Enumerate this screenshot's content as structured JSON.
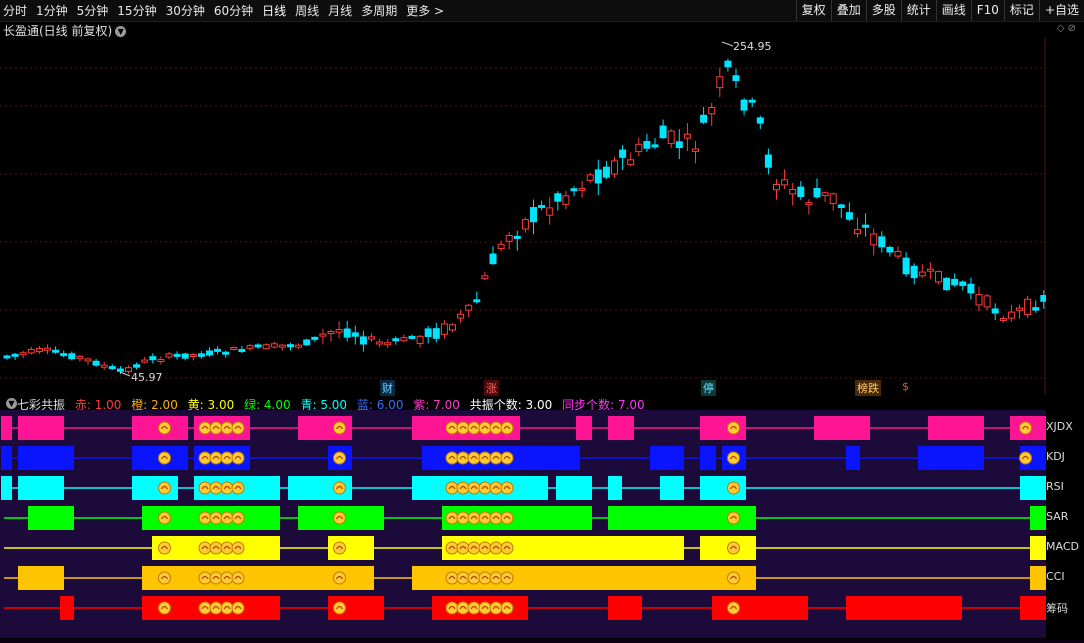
{
  "toolbar": {
    "periods": [
      "分时",
      "1分钟",
      "5分钟",
      "15分钟",
      "30分钟",
      "60分钟",
      "日线",
      "周线",
      "月线",
      "多周期",
      "更多 >"
    ],
    "tools": [
      "复权",
      "叠加",
      "多股",
      "统计",
      "画线",
      "F10",
      "标记",
      "+自选"
    ]
  },
  "chart": {
    "title": "长盈通(日线 前复权)",
    "high_label": "254.95",
    "low_label": "45.97",
    "icons": "◇ ⊘"
  },
  "events": [
    {
      "label": "财",
      "color": "#6fd0ff",
      "bg": "#0a2a44"
    },
    {
      "label": "涨",
      "color": "#ff6060",
      "bg": "#4a0a0a"
    },
    {
      "label": "停",
      "color": "#70e0ff",
      "bg": "#0a3a3a"
    },
    {
      "label": "榜跌",
      "color": "#ffcc66",
      "bg": "#4a2a0a"
    },
    {
      "label": "$",
      "color": "#ff4040",
      "bg": ""
    }
  ],
  "indicator": {
    "name": "七彩共振",
    "items": [
      {
        "text": "赤: 1.00",
        "color": "#ff3b3b"
      },
      {
        "text": "橙: 2.00",
        "color": "#ffb000"
      },
      {
        "text": "黄: 3.00",
        "color": "#ffff00"
      },
      {
        "text": "绿: 4.00",
        "color": "#00ff00"
      },
      {
        "text": "青: 5.00",
        "color": "#00ffff"
      },
      {
        "text": "蓝: 6.00",
        "color": "#3a6bff"
      },
      {
        "text": "紫: 7.00",
        "color": "#ff3bd0"
      },
      {
        "text": "共振个数: 3.00",
        "color": "#ffffff"
      },
      {
        "text": "同步个数: 7.00",
        "color": "#ff33ff"
      }
    ],
    "row_labels": [
      "XJDX",
      "KDJ",
      "RSI",
      "SAR",
      "MACD",
      "CCI",
      "筹码"
    ],
    "row_colors": [
      "#ff1493",
      "#0a14ff",
      "#00ffff",
      "#00ff00",
      "#ffff00",
      "#ffc400",
      "#ff0000"
    ]
  },
  "colors": {
    "up": "#ff3b3b",
    "down": "#00e5ff",
    "grid": "#5a1010",
    "ind_bg": "#1c0a3a"
  }
}
